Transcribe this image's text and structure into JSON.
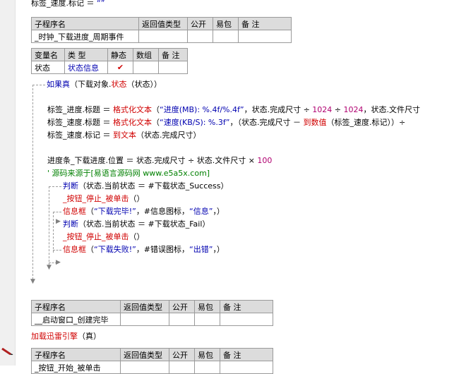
{
  "top_line": {
    "obj": "标签_速度",
    "dot": ".",
    "prop": "标记",
    "op": " ＝ ",
    "val": "“”"
  },
  "sub1": {
    "headers": [
      "子程序名",
      "返回值类型",
      "公开",
      "易包",
      "备 注"
    ],
    "name": "_时钟_下载进度_周期事件"
  },
  "vars": {
    "headers": [
      "变量名",
      "类 型",
      "静态",
      "数组",
      "备 注"
    ],
    "name": "状态",
    "type": "状态信息",
    "static_mark": "✔"
  },
  "code": {
    "if_kw": "如果真",
    "if_args_pre": "（下载对象.",
    "if_args_var": "状态",
    "if_args_post": "（状态））",
    "l1_a": "标签_进度.标题 ＝ ",
    "l1_fn": "格式化文本",
    "l1_b": "（",
    "l1_str": "“进度(MB): %.4f/%.4f”",
    "l1_c": "，状态.完成尺寸 ÷ ",
    "l1_n1": "1024",
    "l1_d": " ÷ ",
    "l1_n2": "1024",
    "l1_e": "，状态.文件尺寸",
    "l2_a": "标签_速度.标题 ＝ ",
    "l2_fn": "格式化文本",
    "l2_b": "（",
    "l2_str": "“速度(KB/S): %.3f”",
    "l2_c": "，（状态.完成尺寸 － ",
    "l2_fn2": "到数值",
    "l2_d": "（标签_速度.标记））÷",
    "l3_a": "标签_速度.标记 ＝ ",
    "l3_fn": "到文本",
    "l3_b": "（状态.完成尺寸）",
    "l4_a": "进度条_下载进度.位置 ＝ 状态.完成尺寸 ÷ 状态.文件尺寸 × ",
    "l4_n": "100",
    "comment": "' 源码来源于[易语言源码网 www.e5a5x.com]",
    "j1_kw": "判断",
    "j1_a": "（状态.当前状态 ＝ #下载状态_Success）",
    "call1": "_按钮_停止_被单击",
    "call1_b": "（）",
    "msg1_fn": "信息框",
    "msg1_a": "（",
    "msg1_s1": "“下载完毕!”",
    "msg1_b": "，#信息图标，",
    "msg1_s2": "“信息”",
    "msg1_c": "，）",
    "j2_kw": "判断",
    "j2_a": "（状态.当前状态 ＝ #下载状态_Fail）",
    "call2": "_按钮_停止_被单击",
    "call2_b": "（）",
    "msg2_fn": "信息框",
    "msg2_a": "（",
    "msg2_s1": "“下载失败!”",
    "msg2_b": "，#错误图标，",
    "msg2_s2": "“出错”",
    "msg2_c": "，）"
  },
  "sub2": {
    "headers": [
      "子程序名",
      "返回值类型",
      "公开",
      "易包",
      "备 注"
    ],
    "name": "__启动窗口_创建完毕"
  },
  "load_line": {
    "fn": "加载迅雷引擎",
    "args": "（真）"
  },
  "sub3": {
    "headers": [
      "子程序名",
      "返回值类型",
      "公开",
      "易包",
      "备 注"
    ],
    "name": "_按钮_开始_被单击"
  },
  "colors": {
    "keyword": "#0000b0",
    "function": "#d00000",
    "constant": "#b00070",
    "comment": "#008000"
  }
}
